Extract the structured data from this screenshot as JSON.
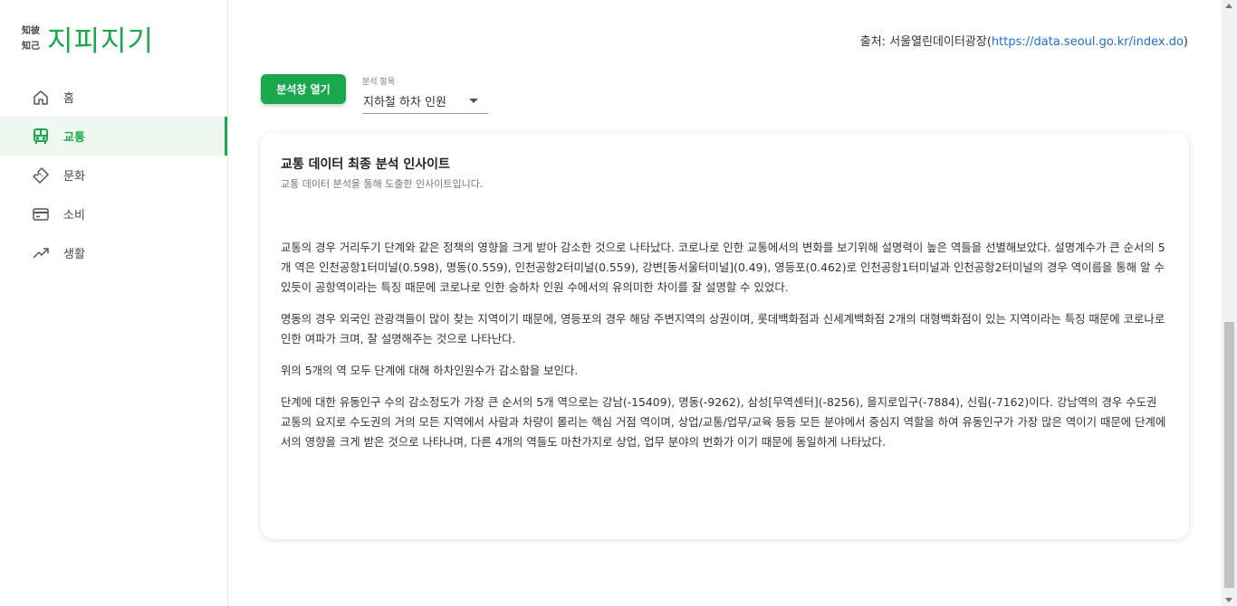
{
  "logo": {
    "small_line1": "知彼",
    "small_line2": "知己",
    "main": "지피지기"
  },
  "sidebar": {
    "items": [
      {
        "label": "홈",
        "icon": "home-icon"
      },
      {
        "label": "교통",
        "icon": "bus-icon",
        "active": true
      },
      {
        "label": "문화",
        "icon": "ticket-icon"
      },
      {
        "label": "소비",
        "icon": "credit-card-icon"
      },
      {
        "label": "생활",
        "icon": "trending-up-icon"
      }
    ]
  },
  "source": {
    "prefix": "출처: 서울열린데이터광장(",
    "link": "https://data.seoul.go.kr/index.do",
    "suffix": ")"
  },
  "toolbar": {
    "open_label": "분석창 열기",
    "select_label": "분석 항목",
    "select_value": "지하철 하차 인원"
  },
  "card": {
    "title": "교통 데이터 최종 분석 인사이트",
    "subtitle": "교통 데이터 분석을 통해 도출한 인사이트입니다.",
    "paragraphs": [
      "교통의 경우 거리두기 단계와 같은 정책의 영향을 크게 받아 감소한 것으로 나타났다. 코로나로 인한 교통에서의 변화를 보기위해 설명력이 높은 역들을 선별해보았다. 설명계수가 큰 순서의 5개 역은 인천공항1터미널(0.598), 명동(0.559), 인천공항2터미널(0.559), 강변[동서울터미널](0.49), 영등포(0.462)로 인천공항1터미널과 인천공항2터미널의 경우 역이름을 통해 알 수 있듯이 공항역이라는 특징 때문에 코로나로 인한 승하차 인원 수에서의 유의미한 차이를 잘 설명할 수 있었다.",
      "명동의 경우 외국인 관광객들이 많이 찾는 지역이기 때문에, 영등포의 경우 해당 주변지역의 상권이며, 롯데백화점과 신세계백화점 2개의 대형백화점이 있는 지역이라는 특징 때문에 코로나로 인한 여파가 크며, 잘 설명해주는 것으로 나타난다.",
      "위의 5개의 역 모두 단계에 대해 하차인원수가 감소함을 보인다.",
      "단계에 대한 유동인구 수의 감소정도가 가장 큰 순서의 5개 역으로는 강남(-15409), 명동(-9262), 삼성[무역센터](-8256), 을지로입구(-7884), 신림(-7162)이다. 강남역의 경우 수도권 교통의 요지로 수도권의 거의 모든 지역에서 사람과 차량이 몰리는 핵심 거점 역이며, 상업/교통/업무/교육 등등 모든 분야에서 중심지 역할을 하여 유동인구가 가장 많은 역이기 때문에 단계에서의 영향을 크게 받은 것으로 나타나며, 다른 4개의 역들도 마찬가지로 상업, 업무 분야의 번화가 이기 때문에 동일하게 나타났다."
    ]
  },
  "colors": {
    "accent": "#1ba74d",
    "link": "#1a6fd6"
  }
}
